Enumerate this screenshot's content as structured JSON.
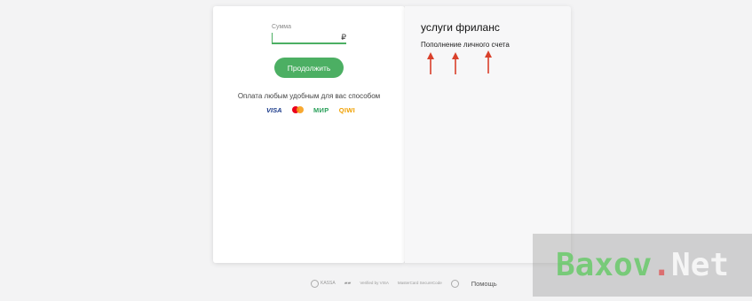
{
  "payment_form": {
    "amount_label": "Сумма",
    "currency_symbol": "₽",
    "continue_label": "Продолжить",
    "payment_note": "Оплата любым удобным для вас способом",
    "methods": {
      "visa": "VISA",
      "mir": "МИР",
      "qiwi": "QIWI"
    }
  },
  "service": {
    "title": "услуги фриланс",
    "subtitle": "Пополнение личного счета"
  },
  "footer": {
    "kassa": "KASSA",
    "visa_label": "Verified by VISA",
    "mastercard_label": "MasterCard SecureCode",
    "help": "Помощь"
  },
  "watermark": {
    "part1": "Baxov",
    "part2": ".",
    "part3": "Net"
  },
  "colors": {
    "accent": "#4caf63",
    "arrow": "#d9402b"
  }
}
